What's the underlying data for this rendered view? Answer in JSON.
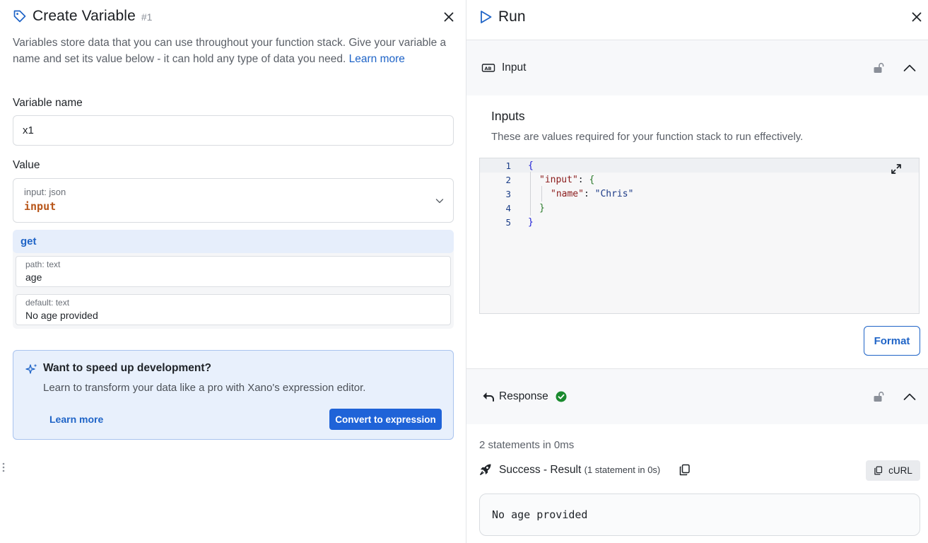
{
  "create_variable": {
    "title": "Create Variable",
    "step_number": "#1",
    "description": "Variables store data that you can use throughout your function stack. Give your variable a name and set its value below - it can hold any type of data you need.",
    "learn_more_link": "Learn more",
    "variable_name_label": "Variable name",
    "variable_name_value": "x1",
    "value_label": "Value",
    "value_select": {
      "type": "input: json",
      "value": "input"
    },
    "filter": {
      "name": "get",
      "args": [
        {
          "type": "path: text",
          "value": "age"
        },
        {
          "type": "default: text",
          "value": "No age provided"
        }
      ]
    },
    "tip": {
      "title": "Want to speed up development?",
      "description": "Learn to transform your data like a pro with Xano's expression editor.",
      "learn_more": "Learn more",
      "convert_button": "Convert to expression"
    }
  },
  "run": {
    "title": "Run",
    "input_section": {
      "label": "Input",
      "inputs_title": "Inputs",
      "inputs_description": "These are values required for your function stack to run effectively.",
      "line_numbers": [
        "1",
        "2",
        "3",
        "4",
        "5"
      ],
      "code": {
        "open_brace": "{",
        "input_key": "\"input\"",
        "name_key": "\"name\"",
        "name_value": "\"Chris\"",
        "inner_close": "}",
        "close_brace": "}"
      },
      "format_button": "Format"
    },
    "response_section": {
      "label": "Response",
      "stats": "2 statements in 0ms",
      "result_label": "Success - Result",
      "result_sub": "(1 statement in 0s)",
      "curl_button": "cURL",
      "output": "No age provided"
    }
  },
  "colors": {
    "accent": "#1f64c7",
    "primary_button": "#1f63d8",
    "success": "#1a8a2e",
    "json_value_color": "#b8561a"
  }
}
